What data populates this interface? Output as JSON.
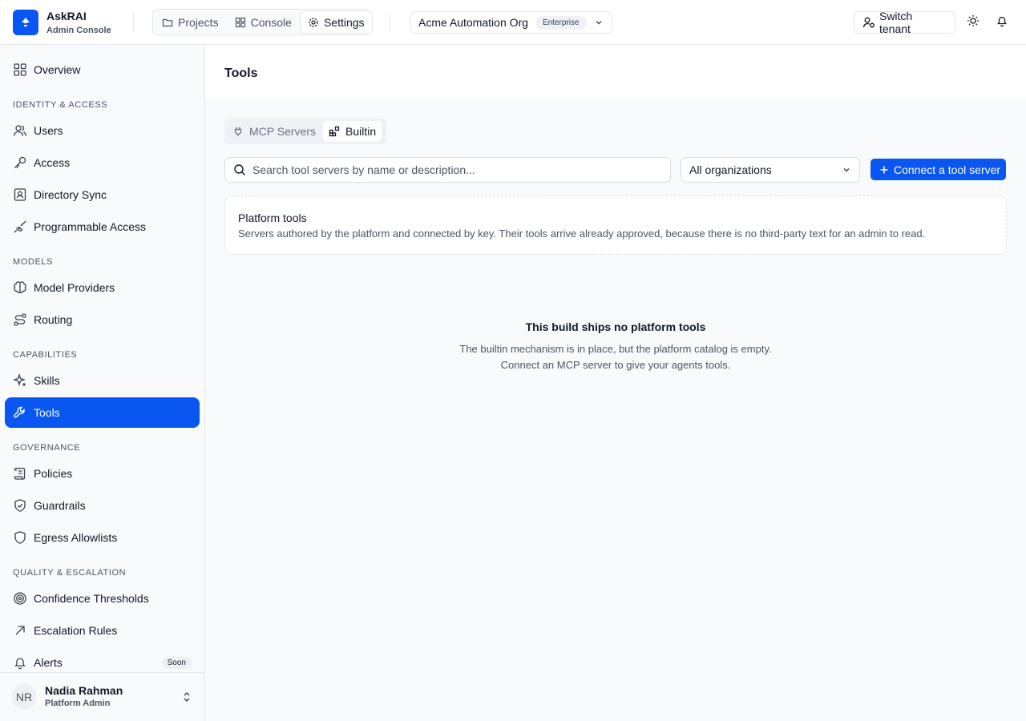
{
  "header": {
    "brand_name": "AskRAI",
    "brand_sub": "Admin Console",
    "nav": [
      {
        "label": "Projects",
        "icon": "folder-icon"
      },
      {
        "label": "Console",
        "icon": "grid-icon"
      },
      {
        "label": "Settings",
        "icon": "gear-icon",
        "active": true
      }
    ],
    "org_name": "Acme Automation Org",
    "org_badge": "Enterprise",
    "switch_label": "Switch tenant"
  },
  "sidebar": {
    "overview": "Overview",
    "sections": {
      "identity": "IDENTITY & ACCESS",
      "models": "MODELS",
      "capabilities": "CAPABILITIES",
      "governance": "GOVERNANCE",
      "quality": "QUALITY & ESCALATION"
    },
    "items": {
      "users": "Users",
      "access": "Access",
      "directory_sync": "Directory Sync",
      "programmable_access": "Programmable Access",
      "model_providers": "Model Providers",
      "routing": "Routing",
      "skills": "Skills",
      "tools": "Tools",
      "policies": "Policies",
      "guardrails": "Guardrails",
      "egress": "Egress Allowlists",
      "confidence": "Confidence Thresholds",
      "escalation": "Escalation Rules",
      "alerts": "Alerts"
    },
    "alerts_badge": "Soon",
    "user": {
      "initials": "NR",
      "name": "Nadia Rahman",
      "role": "Platform Admin"
    }
  },
  "main": {
    "title": "Tools",
    "tabs": [
      {
        "label": "MCP Servers",
        "active": false
      },
      {
        "label": "Builtin",
        "active": true
      }
    ],
    "search_placeholder": "Search tool servers by name or description...",
    "org_filter": "All organizations",
    "connect_label": "Connect a tool server",
    "card": {
      "title": "Platform tools",
      "desc": "Servers authored by the platform and connected by key. Their tools arrive already approved, because there is no third-party text for an admin to read."
    },
    "empty": {
      "title": "This build ships no platform tools",
      "line1": "The builtin mechanism is in place, but the platform catalog is empty.",
      "line2": "Connect an MCP server to give your agents tools."
    }
  },
  "colors": {
    "accent": "#0a56f0",
    "border": "#e5e7eb",
    "muted": "#4b5563"
  }
}
